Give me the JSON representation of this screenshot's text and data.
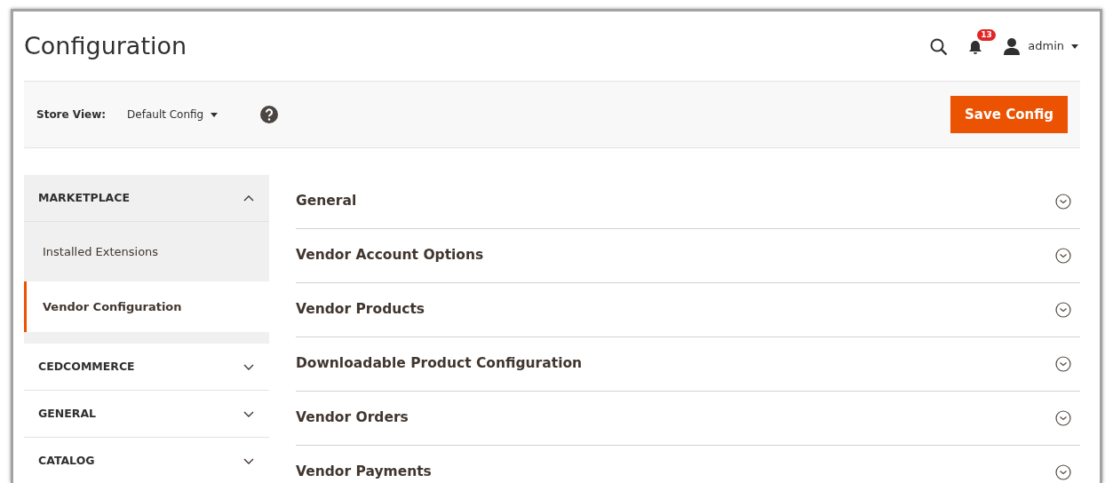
{
  "header": {
    "title": "Configuration",
    "notifications": "13",
    "user": "admin"
  },
  "toolbar": {
    "store_view_label": "Store View:",
    "store_view": "Default Config",
    "save_button": "Save Config"
  },
  "sidebar": {
    "groups": [
      {
        "label": "MARKETPLACE",
        "expanded": true,
        "children": [
          {
            "label": "Installed Extensions",
            "selected": false
          },
          {
            "label": "Vendor Configuration",
            "selected": true
          }
        ]
      },
      {
        "label": "CEDCOMMERCE",
        "expanded": false
      },
      {
        "label": "GENERAL",
        "expanded": false
      },
      {
        "label": "CATALOG",
        "expanded": false
      }
    ]
  },
  "sections": [
    {
      "title": "General",
      "expanded": false
    },
    {
      "title": "Vendor Account Options",
      "expanded": false
    },
    {
      "title": "Vendor Products",
      "expanded": false
    },
    {
      "title": "Downloadable Product Configuration",
      "expanded": false
    },
    {
      "title": "Vendor Orders",
      "expanded": false
    },
    {
      "title": "Vendor Payments",
      "expanded": false
    }
  ]
}
